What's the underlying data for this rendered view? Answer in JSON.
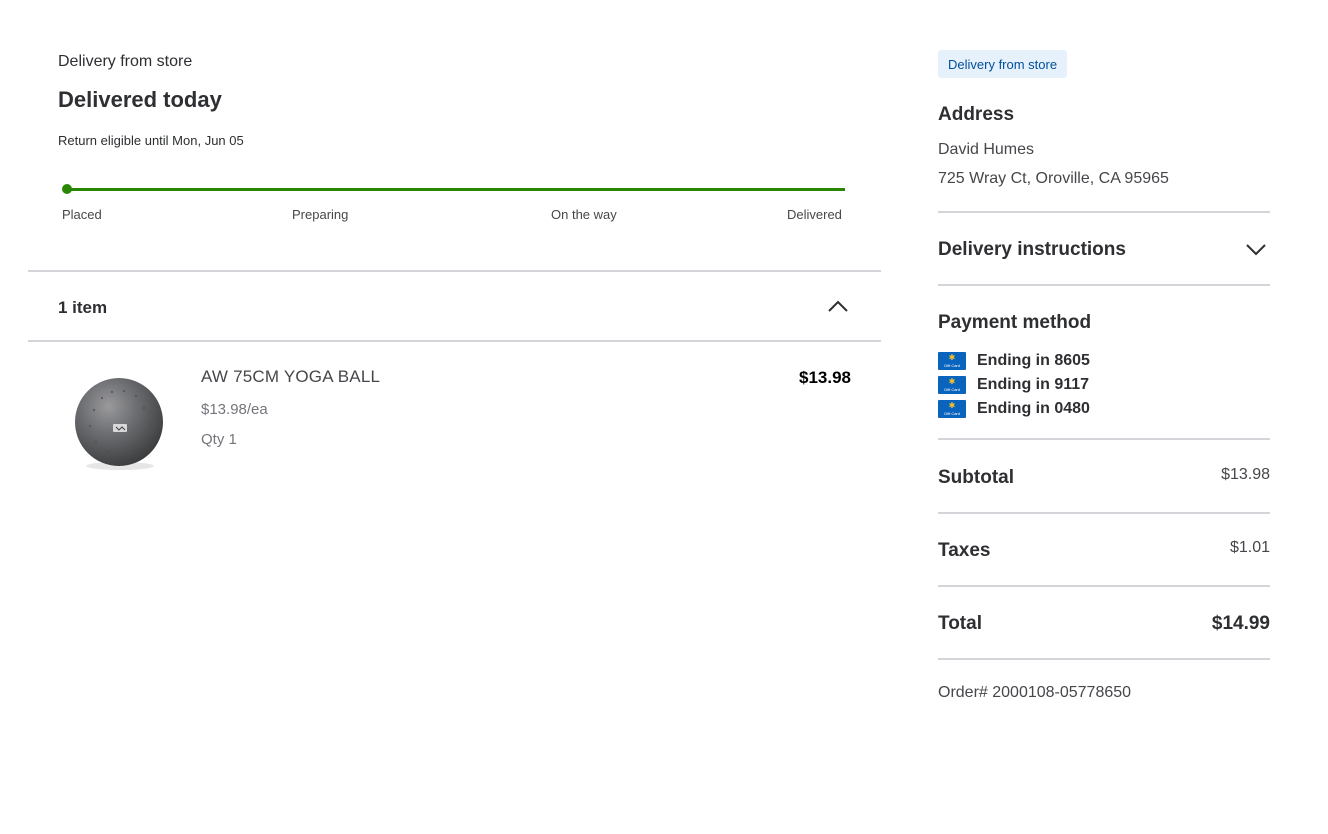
{
  "order": {
    "fulfillment": "Delivery from store",
    "status": "Delivered today",
    "return_note": "Return eligible until Mon, Jun 05",
    "progress": {
      "steps": [
        "Placed",
        "Preparing",
        "On the way",
        "Delivered"
      ],
      "completed_fraction": 1.0,
      "color": "#2a8703"
    }
  },
  "items_section": {
    "count_label": "1 item",
    "items": [
      {
        "name": "AW 75CM YOGA BALL",
        "unit_price": "$13.98/ea",
        "qty": "Qty 1",
        "price": "$13.98"
      }
    ]
  },
  "summary": {
    "badge": "Delivery from store",
    "address_title": "Address",
    "address_name": "David Humes",
    "address_line": "725 Wray Ct, Oroville, CA 95965",
    "delivery_instructions_title": "Delivery instructions",
    "payment_title": "Payment method",
    "payment_cards": [
      {
        "label": "Ending in 8605",
        "icon": "gift-card-icon"
      },
      {
        "label": "Ending in 9117",
        "icon": "gift-card-icon"
      },
      {
        "label": "Ending in 0480",
        "icon": "gift-card-icon"
      }
    ],
    "subtotal_label": "Subtotal",
    "subtotal_value": "$13.98",
    "taxes_label": "Taxes",
    "taxes_value": "$1.01",
    "total_label": "Total",
    "total_value": "$14.99",
    "order_number": "Order# 2000108-05778650"
  },
  "colors": {
    "accent_green": "#2a8703",
    "badge_bg": "#e6f1fc",
    "badge_text": "#004f9a",
    "gift_card_blue": "#0a64bd",
    "walmart_spark": "#ffc220"
  }
}
